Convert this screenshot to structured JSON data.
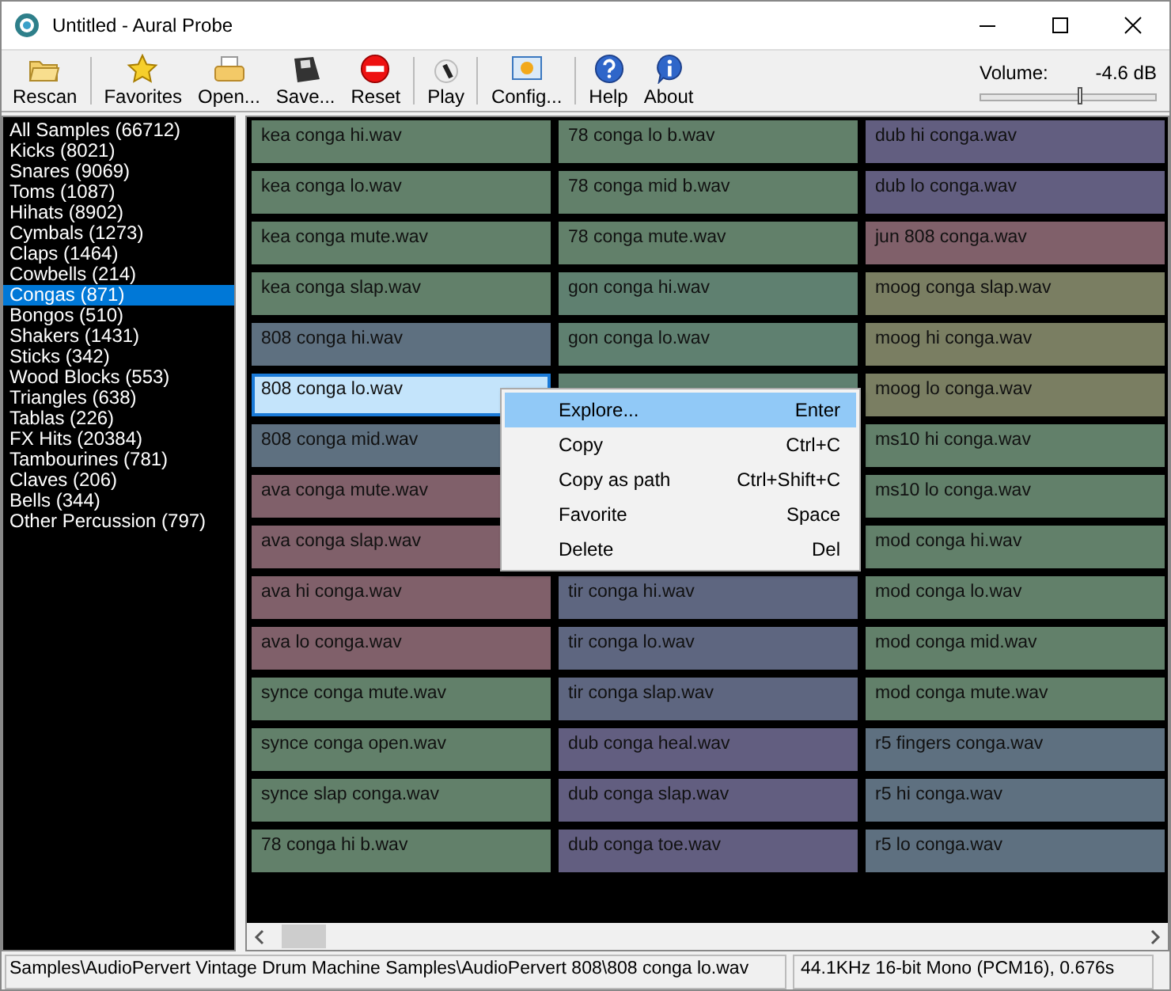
{
  "window": {
    "title": "Untitled - Aural Probe"
  },
  "toolbar": {
    "groups": [
      [
        {
          "label": "Rescan",
          "kind": "folder"
        }
      ],
      [
        {
          "label": "Favorites",
          "kind": "star"
        },
        {
          "label": "Open...",
          "kind": "open"
        },
        {
          "label": "Save...",
          "kind": "save"
        },
        {
          "label": "Reset",
          "kind": "reset"
        }
      ],
      [
        {
          "label": "Play",
          "kind": "play"
        }
      ],
      [
        {
          "label": "Config...",
          "kind": "config"
        }
      ],
      [
        {
          "label": "Help",
          "kind": "help"
        },
        {
          "label": "About",
          "kind": "about"
        }
      ]
    ]
  },
  "volume": {
    "label": "Volume:",
    "reading": "-4.6 dB",
    "level": 0.57
  },
  "sidebar": {
    "items": [
      {
        "label": "All Samples (66712)",
        "selected": false
      },
      {
        "label": "Kicks (8021)",
        "selected": false
      },
      {
        "label": "Snares (9069)",
        "selected": false
      },
      {
        "label": "Toms (1087)",
        "selected": false
      },
      {
        "label": "Hihats (8902)",
        "selected": false
      },
      {
        "label": "Cymbals (1273)",
        "selected": false
      },
      {
        "label": "Claps (1464)",
        "selected": false
      },
      {
        "label": "Cowbells (214)",
        "selected": false
      },
      {
        "label": "Congas (871)",
        "selected": true
      },
      {
        "label": "Bongos (510)",
        "selected": false
      },
      {
        "label": "Shakers (1431)",
        "selected": false
      },
      {
        "label": "Sticks (342)",
        "selected": false
      },
      {
        "label": "Wood Blocks (553)",
        "selected": false
      },
      {
        "label": "Triangles (638)",
        "selected": false
      },
      {
        "label": "Tablas (226)",
        "selected": false
      },
      {
        "label": "FX Hits (20384)",
        "selected": false
      },
      {
        "label": "Tambourines (781)",
        "selected": false
      },
      {
        "label": "Claves (206)",
        "selected": false
      },
      {
        "label": "Bells (344)",
        "selected": false
      },
      {
        "label": "Other Percussion (797)",
        "selected": false
      }
    ]
  },
  "samples": {
    "columns": [
      [
        {
          "kind": "sample",
          "name": "kea conga hi.wav",
          "color": "#62806a",
          "selected": false
        },
        {
          "kind": "sample",
          "name": "kea conga lo.wav",
          "color": "#62806a",
          "selected": false
        },
        {
          "kind": "sample",
          "name": "kea conga mute.wav",
          "color": "#62806a",
          "selected": false
        },
        {
          "kind": "sample",
          "name": "kea conga slap.wav",
          "color": "#62806a",
          "selected": false
        },
        {
          "kind": "sample",
          "name": "808 conga hi.wav",
          "color": "#5e7080",
          "selected": false
        },
        {
          "kind": "sample",
          "name": "808 conga lo.wav",
          "selected": true
        },
        {
          "kind": "sample",
          "name": "808 conga mid.wav",
          "color": "#5e7080",
          "selected": false
        },
        {
          "kind": "sample",
          "name": "ava conga mute.wav",
          "color": "#80606a",
          "selected": false
        },
        {
          "kind": "sample",
          "name": "ava conga slap.wav",
          "color": "#80606a",
          "selected": false
        },
        {
          "kind": "sample",
          "name": "ava hi conga.wav",
          "color": "#80606a",
          "selected": false
        },
        {
          "kind": "sample",
          "name": "ava lo conga.wav",
          "color": "#80606a",
          "selected": false
        },
        {
          "kind": "sample",
          "name": "synce conga mute.wav",
          "color": "#62806a",
          "selected": false
        },
        {
          "kind": "sample",
          "name": "synce conga open.wav",
          "color": "#62806a",
          "selected": false
        },
        {
          "kind": "sample",
          "name": "synce slap conga.wav",
          "color": "#62806a",
          "selected": false
        },
        {
          "kind": "sample",
          "name": "78 conga hi b.wav",
          "color": "#62806a",
          "selected": false
        }
      ],
      [
        {
          "kind": "sample",
          "name": "78 conga lo b.wav",
          "color": "#62806a",
          "selected": false
        },
        {
          "kind": "sample",
          "name": "78 conga mid b.wav",
          "color": "#62806a",
          "selected": false
        },
        {
          "kind": "sample",
          "name": "78 conga mute.wav",
          "color": "#62806a",
          "selected": false
        },
        {
          "kind": "sample",
          "name": "gon conga hi.wav",
          "color": "#5f8070",
          "selected": false
        },
        {
          "kind": "sample",
          "name": "gon conga lo.wav",
          "color": "#5f8070",
          "selected": false
        },
        {
          "kind": "covered",
          "color": "#5f8070"
        },
        {
          "kind": "covered"
        },
        {
          "kind": "covered"
        },
        {
          "kind": "covered"
        },
        {
          "kind": "sample",
          "name": "tir conga hi.wav",
          "color": "#5e6680",
          "selected": false
        },
        {
          "kind": "sample",
          "name": "tir conga lo.wav",
          "color": "#5e6680",
          "selected": false
        },
        {
          "kind": "sample",
          "name": "tir conga slap.wav",
          "color": "#5e6680",
          "selected": false
        },
        {
          "kind": "sample",
          "name": "dub conga heal.wav",
          "color": "#625e80",
          "selected": false
        },
        {
          "kind": "sample",
          "name": "dub conga slap.wav",
          "color": "#625e80",
          "selected": false
        },
        {
          "kind": "sample",
          "name": "dub conga toe.wav",
          "color": "#625e80",
          "selected": false
        }
      ],
      [
        {
          "kind": "sample",
          "name": "dub hi conga.wav",
          "color": "#625e80",
          "selected": false
        },
        {
          "kind": "sample",
          "name": "dub lo conga.wav",
          "color": "#625e80",
          "selected": false
        },
        {
          "kind": "sample",
          "name": "jun 808 conga.wav",
          "color": "#80606a",
          "selected": false
        },
        {
          "kind": "sample",
          "name": "moog conga slap.wav",
          "color": "#7a7e62",
          "selected": false
        },
        {
          "kind": "sample",
          "name": "moog hi conga.wav",
          "color": "#7a7e62",
          "selected": false
        },
        {
          "kind": "sample",
          "name": "moog lo conga.wav",
          "color": "#7a7e62",
          "selected": false
        },
        {
          "kind": "sample",
          "name": "ms10 hi conga.wav",
          "color": "#62806a",
          "selected": false
        },
        {
          "kind": "sample",
          "name": "ms10 lo conga.wav",
          "color": "#62806a",
          "selected": false
        },
        {
          "kind": "sample",
          "name": "mod conga hi.wav",
          "color": "#62806a",
          "selected": false
        },
        {
          "kind": "sample",
          "name": "mod conga lo.wav",
          "color": "#62806a",
          "selected": false
        },
        {
          "kind": "sample",
          "name": "mod conga mid.wav",
          "color": "#62806a",
          "selected": false
        },
        {
          "kind": "sample",
          "name": "mod conga mute.wav",
          "color": "#62806a",
          "selected": false
        },
        {
          "kind": "sample",
          "name": "r5 fingers conga.wav",
          "color": "#5e7080",
          "selected": false
        },
        {
          "kind": "sample",
          "name": "r5 hi conga.wav",
          "color": "#5e7080",
          "selected": false
        },
        {
          "kind": "sample",
          "name": "r5 lo conga.wav",
          "color": "#5e7080",
          "selected": false
        }
      ]
    ]
  },
  "context_menu": {
    "items": [
      {
        "label": "Explore...",
        "shortcut": "Enter",
        "selected": true
      },
      {
        "label": "Copy",
        "shortcut": "Ctrl+C",
        "selected": false
      },
      {
        "label": "Copy as path",
        "shortcut": "Ctrl+Shift+C",
        "selected": false
      },
      {
        "label": "Favorite",
        "shortcut": "Space",
        "selected": false
      },
      {
        "label": "Delete",
        "shortcut": "Del",
        "selected": false
      }
    ]
  },
  "status_bar": {
    "path": "Samples\\AudioPervert Vintage Drum Machine Samples\\AudioPervert 808\\808 conga lo.wav",
    "info": "44.1KHz 16-bit Mono (PCM16), 0.676s"
  }
}
